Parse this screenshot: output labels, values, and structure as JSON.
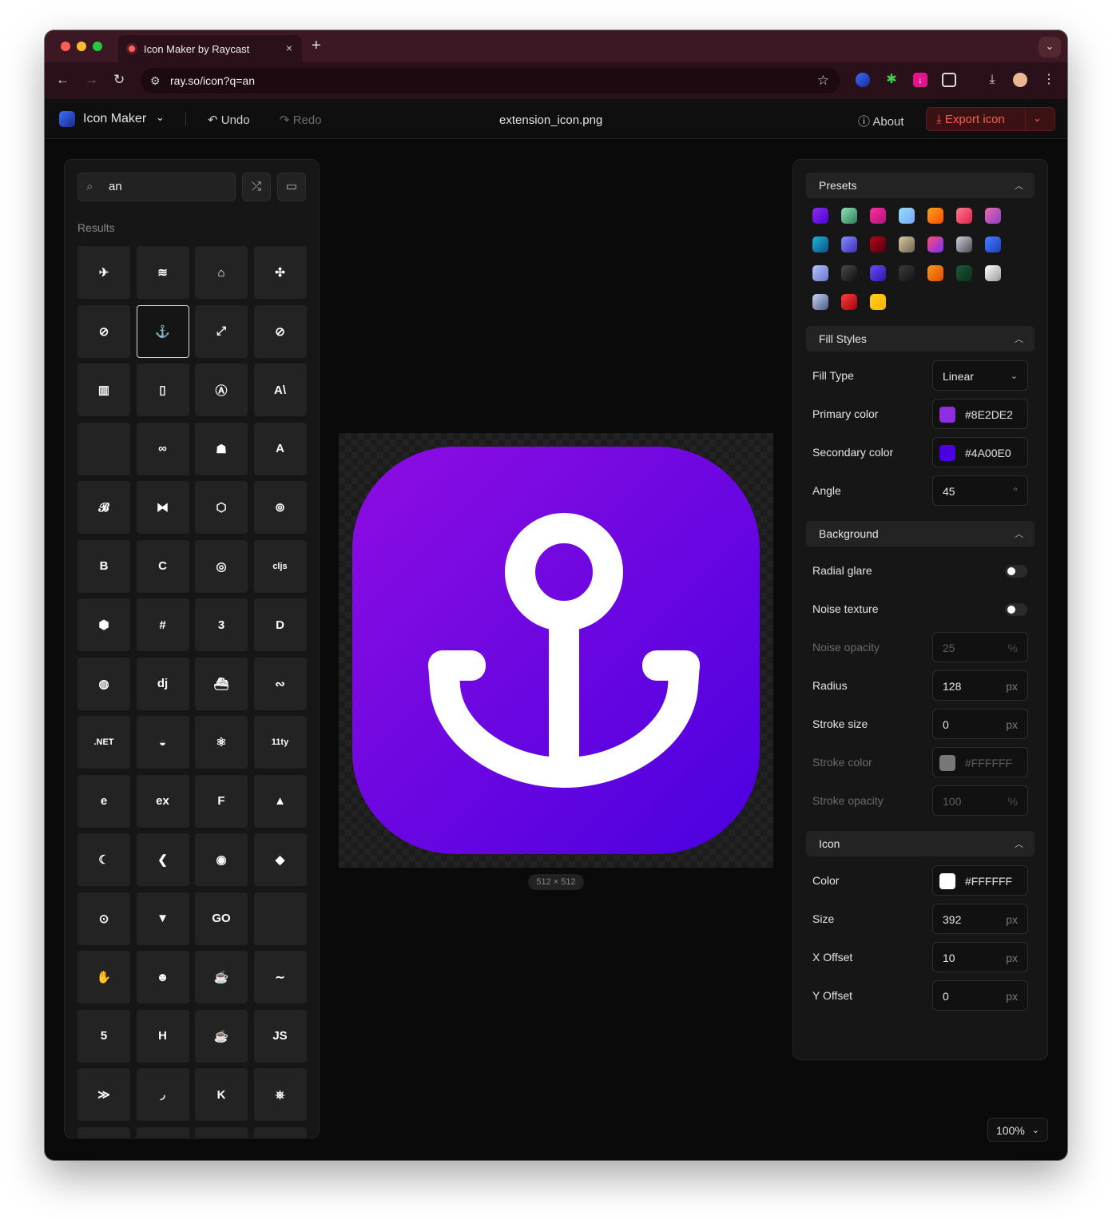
{
  "browser": {
    "tab_title": "Icon Maker by Raycast",
    "close_glyph": "×",
    "new_tab_glyph": "+",
    "tabs_menu_glyph": "⌄",
    "url": "ray.so/icon?q=an",
    "colors": {
      "tab_strip": "#3b1824",
      "toolbar": "#2a1119",
      "traffic_red": "#ff5f57",
      "traffic_yellow": "#febc2e",
      "traffic_green": "#28c840"
    }
  },
  "header": {
    "app_name": "Icon Maker",
    "undo_label": "Undo",
    "redo_label": "Redo",
    "file_name": "extension_icon.png",
    "about_label": "About",
    "export_label": "Export icon"
  },
  "left": {
    "search_value": "an",
    "results_label": "Results",
    "icons": [
      "airplane-icon",
      "airplane-landing-icon",
      "airplane-takeoff-icon",
      "airplane-outline-icon",
      "american-football-icon",
      "anchor-icon",
      "arrows-expand-icon",
      "american-football-outline-icon",
      "map-icon",
      "document-icon",
      "angular-icon",
      "anthropic-icon",
      "apple-icon",
      "infinity-icon",
      "ansible-robot-icon",
      "arch-icon",
      "babel-icon",
      "bitwarden-icon",
      "box-icon",
      "blender-icon",
      "bootstrap-icon",
      "ccleaner-icon",
      "circleci-icon",
      "clojurescript-icon",
      "crystal-icon",
      "csharp-icon",
      "css3-icon",
      "dart-icon",
      "dapr-icon",
      "django-icon",
      "docker-icon",
      "deepin-icon",
      "dotnet-icon",
      "drupal-icon",
      "electron-icon",
      "eleventy-icon",
      "elementor-icon",
      "express-icon",
      "figma-icon",
      "firebase-icon",
      "flutter-moon-icon",
      "flutter-icon",
      "flask-icon",
      "git-icon",
      "github-icon",
      "gitlab-icon",
      "go-icon",
      "blank-icon",
      "hand-icon",
      "hedgehog-icon",
      "hugging-icon",
      "hyphen-icon",
      "html5-icon",
      "hashnode-icon",
      "java-icon",
      "javascript-icon",
      "jira-icon",
      "jquery-icon",
      "kotlin-icon",
      "kubernetes-icon"
    ],
    "glyphs": [
      "✈",
      "≋",
      "⌂",
      "✣",
      "⊘",
      "⚓",
      "⤢",
      "⊘",
      "▥",
      "▯",
      "Ⓐ",
      "A\\",
      "",
      "∞",
      "☗",
      "A",
      "𝓑",
      "⧓",
      "⬡",
      "⊚",
      "B",
      "C",
      "◎",
      "cljs",
      "⬢",
      "#",
      "3",
      "D",
      "◍",
      "dj",
      "⛴",
      "∾",
      ".NET",
      "◒",
      "⚛",
      "11ty",
      "e",
      "ex",
      "F",
      "▲",
      "☾",
      "❮",
      "◉",
      "◆",
      "⊙",
      "▼",
      "GO",
      "",
      "✋",
      "☻",
      "☕",
      "∼",
      "5",
      "H",
      "☕",
      "JS",
      "≫",
      "◞",
      "K",
      "⎈"
    ],
    "selected_index": 5
  },
  "canvas": {
    "dimensions_label": "512 × 512",
    "icon_name": "anchor-icon",
    "gradient_start": "#8e0de2",
    "gradient_end": "#4a00e0"
  },
  "right": {
    "presets_title": "Presets",
    "presets": [
      "linear-gradient(135deg,#8e2de2,#4a00e0)",
      "linear-gradient(135deg,#8fe3b7,#2e7d5b)",
      "linear-gradient(135deg,#ff2fa0,#b0127a)",
      "linear-gradient(135deg,#8fe3f5,#7aa3ff)",
      "linear-gradient(135deg,#ffa01a,#ff4d00)",
      "linear-gradient(135deg,#ff7a8a,#e02050)",
      "linear-gradient(135deg,#e86ab0,#8b3fc2)",
      "linear-gradient(135deg,#1fb6d6,#0b4f8a)",
      "linear-gradient(135deg,#8a8aff,#3b2fb8)",
      "linear-gradient(135deg,#c00018,#4a0010)",
      "linear-gradient(135deg,#d8c9a0,#6e6650)",
      "linear-gradient(135deg,#ff4d6d,#7a2fff)",
      "linear-gradient(135deg,#d0d0d8,#4a4a58)",
      "linear-gradient(135deg,#4a7dff,#1a3fc0)",
      "linear-gradient(135deg,#b6c2ff,#6a76c8)",
      "linear-gradient(135deg,#4a4a4a,#101010)",
      "linear-gradient(135deg,#6a4aff,#2a1aa0)",
      "linear-gradient(135deg,#3a3a3a,#151515)",
      "linear-gradient(135deg,#ff9a1a,#e04a00)",
      "linear-gradient(135deg,#1f5a3a,#0c2a1a)",
      "linear-gradient(135deg,#ffffff,#9a9a9a)",
      "linear-gradient(135deg,#c6d4f0,#4a5a88)",
      "linear-gradient(135deg,#ff4040,#a00010)",
      "linear-gradient(135deg,#ffd21a,#ffb000)"
    ],
    "fill_title": "Fill Styles",
    "fill_type_label": "Fill Type",
    "fill_type_value": "Linear",
    "primary_label": "Primary color",
    "primary_value": "#8E2DE2",
    "primary_swatch": "#8e2de2",
    "secondary_label": "Secondary color",
    "secondary_value": "#4A00E0",
    "secondary_swatch": "#4a00e0",
    "angle_label": "Angle",
    "angle_value": "45",
    "angle_unit": "°",
    "background_title": "Background",
    "radial_glare_label": "Radial glare",
    "radial_glare_on": false,
    "noise_texture_label": "Noise texture",
    "noise_texture_on": false,
    "noise_opacity_label": "Noise opacity",
    "noise_opacity_value": "25",
    "radius_label": "Radius",
    "radius_value": "128",
    "stroke_size_label": "Stroke size",
    "stroke_size_value": "0",
    "stroke_color_label": "Stroke color",
    "stroke_color_value": "#FFFFFF",
    "stroke_opacity_label": "Stroke opacity",
    "stroke_opacity_value": "100",
    "icon_title": "Icon",
    "icon_color_label": "Color",
    "icon_color_value": "#FFFFFF",
    "size_label": "Size",
    "size_value": "392",
    "x_offset_label": "X Offset",
    "x_offset_value": "10",
    "y_offset_label": "Y Offset",
    "y_offset_value": "0",
    "unit_px": "px",
    "unit_pct": "%"
  },
  "zoom_value": "100%"
}
